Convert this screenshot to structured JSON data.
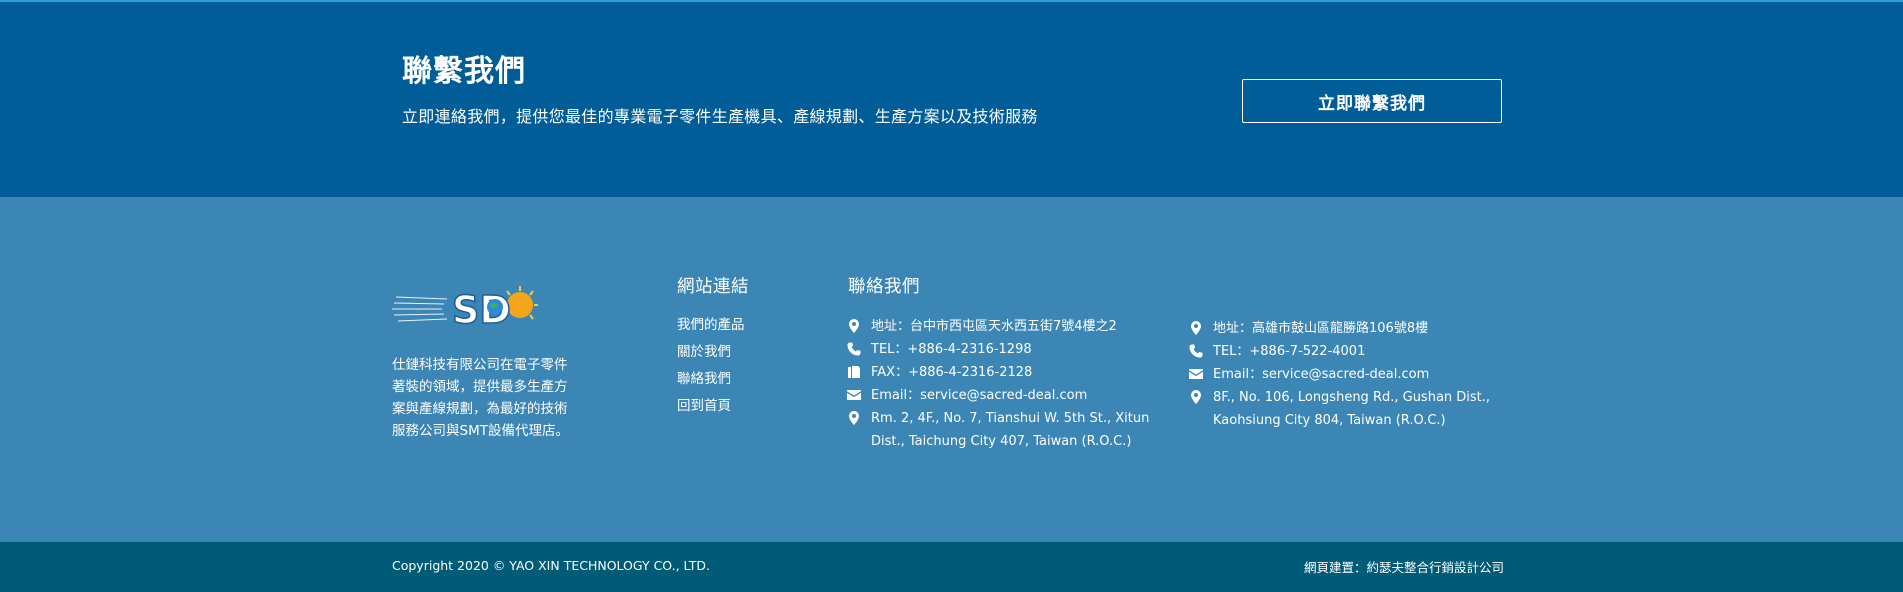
{
  "cta": {
    "title": "聯繫我們",
    "description": "立即連絡我們，提供您最佳的專業電子零件生產機具、產線規劃、生產方案以及技術服務",
    "button_label": "立即聯繫我們"
  },
  "about": {
    "logo_text": "SD",
    "lines": [
      "仕鏈科技有限公司在電子零件",
      "著裝的領域，提供最多生產方",
      "案與產線規劃，為最好的技術",
      "服務公司與SMT設備代理店。"
    ]
  },
  "links": {
    "title": "網站連結",
    "items": [
      "我們的產品",
      "關於我們",
      "聯絡我們",
      "回到首頁"
    ]
  },
  "contact": {
    "title": "聯絡我們",
    "taichung": {
      "address": "地址：台中市西屯區天水西五街7號4樓之2",
      "tel": "TEL：+886-4-2316-1298",
      "fax": "FAX：+886-4-2316-2128",
      "email": "Email：service@sacred-deal.com",
      "address_en": "Rm. 2, 4F., No. 7, Tianshui W. 5th St., Xitun Dist., Taichung City 407, Taiwan (R.O.C.)"
    },
    "kaohsiung": {
      "address": "地址：高雄市鼓山區龍勝路106號8樓",
      "tel": "TEL：+886-7-522-4001",
      "email": "Email：service@sacred-deal.com",
      "address_en": "8F., No. 106, Longsheng Rd., Gushan Dist., Kaohsiung City 804, Taiwan (R.O.C.)"
    }
  },
  "footer": {
    "copyright": "Copyright 2020 © YAO XIN TECHNOLOGY CO., LTD.",
    "credit": "網頁建置：約瑟夫整合行銷設計公司"
  },
  "colors": {
    "cta_bg": "#005d97",
    "footer_bg": "#3c86b5",
    "bottom_bar_bg": "#005b77",
    "text": "#ffffff"
  },
  "icons": {
    "address": "map-pin-icon",
    "tel": "phone-icon",
    "fax": "fax-icon",
    "email": "envelope-icon"
  }
}
